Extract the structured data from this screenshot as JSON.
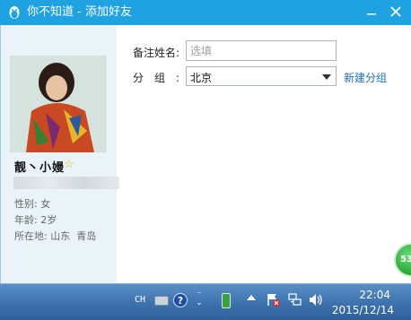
{
  "window": {
    "title": "你不知道 - 添加好友"
  },
  "profile": {
    "nickname": "靓丶小嫚",
    "gender_label": "性别:",
    "gender": "女",
    "age_label": "年龄:",
    "age": "2岁",
    "location_label": "所在地:",
    "province": "山东",
    "city": "青岛"
  },
  "form": {
    "remark_label": "备注姓名:",
    "remark_placeholder": "选填",
    "remark_value": "",
    "group_label": "分组:",
    "group_selected": "北京",
    "new_group_link": "新建分组"
  },
  "float_ball": {
    "text": "53"
  },
  "taskbar": {
    "lang": "CH",
    "help_glyph": "?",
    "time": "22:04",
    "date": "2015/12/14"
  },
  "colors": {
    "titlebar": "#1fa2e1",
    "link": "#1e6fb8",
    "taskbar": "#3f74b0"
  }
}
